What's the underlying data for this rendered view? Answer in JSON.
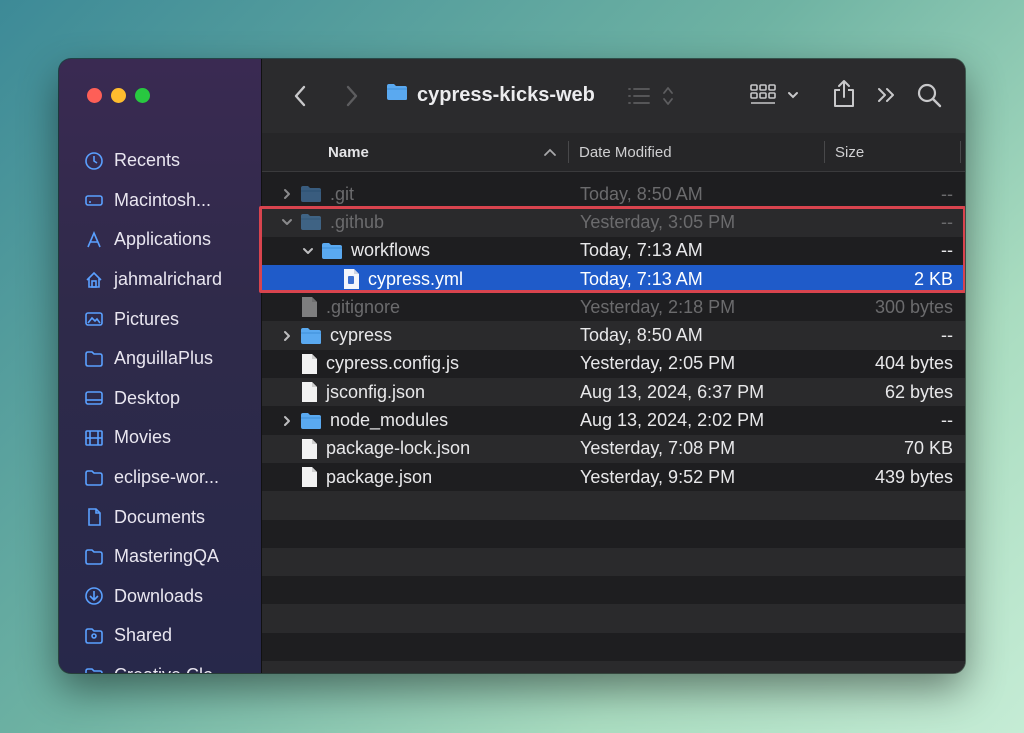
{
  "window": {
    "title": "cypress-kicks-web",
    "traffic_lights": [
      "close",
      "minimize",
      "zoom"
    ]
  },
  "sidebar": {
    "items": [
      {
        "label": "Recents",
        "icon": "clock-icon"
      },
      {
        "label": "Macintosh...",
        "icon": "drive-icon"
      },
      {
        "label": "Applications",
        "icon": "applications-icon"
      },
      {
        "label": "jahmalrichard",
        "icon": "home-icon"
      },
      {
        "label": "Pictures",
        "icon": "photo-icon"
      },
      {
        "label": "AnguillaPlus",
        "icon": "folder-icon"
      },
      {
        "label": "Desktop",
        "icon": "desktop-icon"
      },
      {
        "label": "Movies",
        "icon": "film-icon"
      },
      {
        "label": "eclipse-wor...",
        "icon": "folder-icon"
      },
      {
        "label": "Documents",
        "icon": "document-icon"
      },
      {
        "label": "MasteringQA",
        "icon": "folder-icon"
      },
      {
        "label": "Downloads",
        "icon": "download-icon"
      },
      {
        "label": "Shared",
        "icon": "shared-folder-icon"
      },
      {
        "label": "Creative Clo...",
        "icon": "folder-icon"
      }
    ]
  },
  "columns": {
    "name": "Name",
    "date": "Date Modified",
    "size": "Size"
  },
  "files": [
    {
      "name": ".git",
      "date": "Today, 8:50 AM",
      "size": "--",
      "type": "folder",
      "indent": 0,
      "chevron": "collapsed",
      "dim": true
    },
    {
      "name": ".github",
      "date": "Yesterday, 3:05 PM",
      "size": "--",
      "type": "folder",
      "indent": 0,
      "chevron": "expanded",
      "dim": true
    },
    {
      "name": "workflows",
      "date": "Today, 7:13 AM",
      "size": "--",
      "type": "folder",
      "indent": 1,
      "chevron": "expanded",
      "dim": false
    },
    {
      "name": "cypress.yml",
      "date": "Today, 7:13 AM",
      "size": "2 KB",
      "type": "yml",
      "indent": 2,
      "chevron": "none",
      "dim": false,
      "selected": true
    },
    {
      "name": ".gitignore",
      "date": "Yesterday, 2:18 PM",
      "size": "300 bytes",
      "type": "file",
      "indent": 0,
      "chevron": "none",
      "dim": true
    },
    {
      "name": "cypress",
      "date": "Today, 8:50 AM",
      "size": "--",
      "type": "folder",
      "indent": 0,
      "chevron": "collapsed",
      "dim": false
    },
    {
      "name": "cypress.config.js",
      "date": "Yesterday, 2:05 PM",
      "size": "404 bytes",
      "type": "file",
      "indent": 0,
      "chevron": "none",
      "dim": false
    },
    {
      "name": "jsconfig.json",
      "date": "Aug 13, 2024, 6:37 PM",
      "size": "62 bytes",
      "type": "file",
      "indent": 0,
      "chevron": "none",
      "dim": false
    },
    {
      "name": "node_modules",
      "date": "Aug 13, 2024, 2:02 PM",
      "size": "--",
      "type": "folder",
      "indent": 0,
      "chevron": "collapsed",
      "dim": false
    },
    {
      "name": "package-lock.json",
      "date": "Yesterday, 7:08 PM",
      "size": "70 KB",
      "type": "file",
      "indent": 0,
      "chevron": "none",
      "dim": false
    },
    {
      "name": "package.json",
      "date": "Yesterday, 9:52 PM",
      "size": "439 bytes",
      "type": "file",
      "indent": 0,
      "chevron": "none",
      "dim": false
    }
  ],
  "empty_rows": 7,
  "colors": {
    "accent": "#1f5bc9",
    "folder": "#5aa9f0",
    "highlight_border": "#d8444e",
    "sidebar_icon": "#5aa0ff"
  }
}
